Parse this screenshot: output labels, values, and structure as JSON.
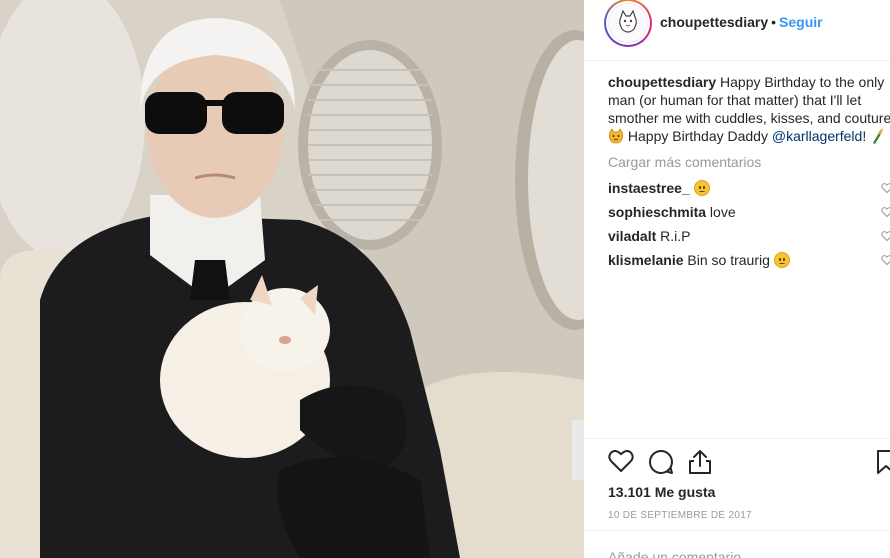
{
  "header": {
    "username": "choupettesdiary",
    "separator": "•",
    "follow_label": "Seguir",
    "avatar_icon": "cat-avatar-icon"
  },
  "caption": {
    "username": "choupettesdiary",
    "line1": "Happy Birthday to the only",
    "line2": "man (or human for that matter) that I'll let",
    "line3": "smother me with cuddles, kisses, and couture.",
    "line4_text": "Happy Birthday Daddy",
    "mention": "@karllagerfeld",
    "line4_end": "!"
  },
  "load_more_label": "Cargar más comentarios",
  "comments": [
    {
      "username": "instaestree_",
      "text": "",
      "emoji": "sad-face"
    },
    {
      "username": "sophieschmita",
      "text": "love",
      "emoji": ""
    },
    {
      "username": "viladalt",
      "text": "R.i.P",
      "emoji": ""
    },
    {
      "username": "klismelanie",
      "text": "Bin so traurig",
      "emoji": "sad-face"
    }
  ],
  "actions": {
    "like_icon": "heart-icon",
    "comment_icon": "comment-icon",
    "share_icon": "share-icon",
    "save_icon": "bookmark-icon"
  },
  "likes_label": "13.101 Me gusta",
  "date_label": "10 DE SEPTIEMBRE DE 2017",
  "add_comment_placeholder": "Añade un comentario...",
  "colors": {
    "link_blue": "#3897f0",
    "muted_gray": "#999999",
    "mention_blue": "#003569",
    "text": "#262626"
  }
}
